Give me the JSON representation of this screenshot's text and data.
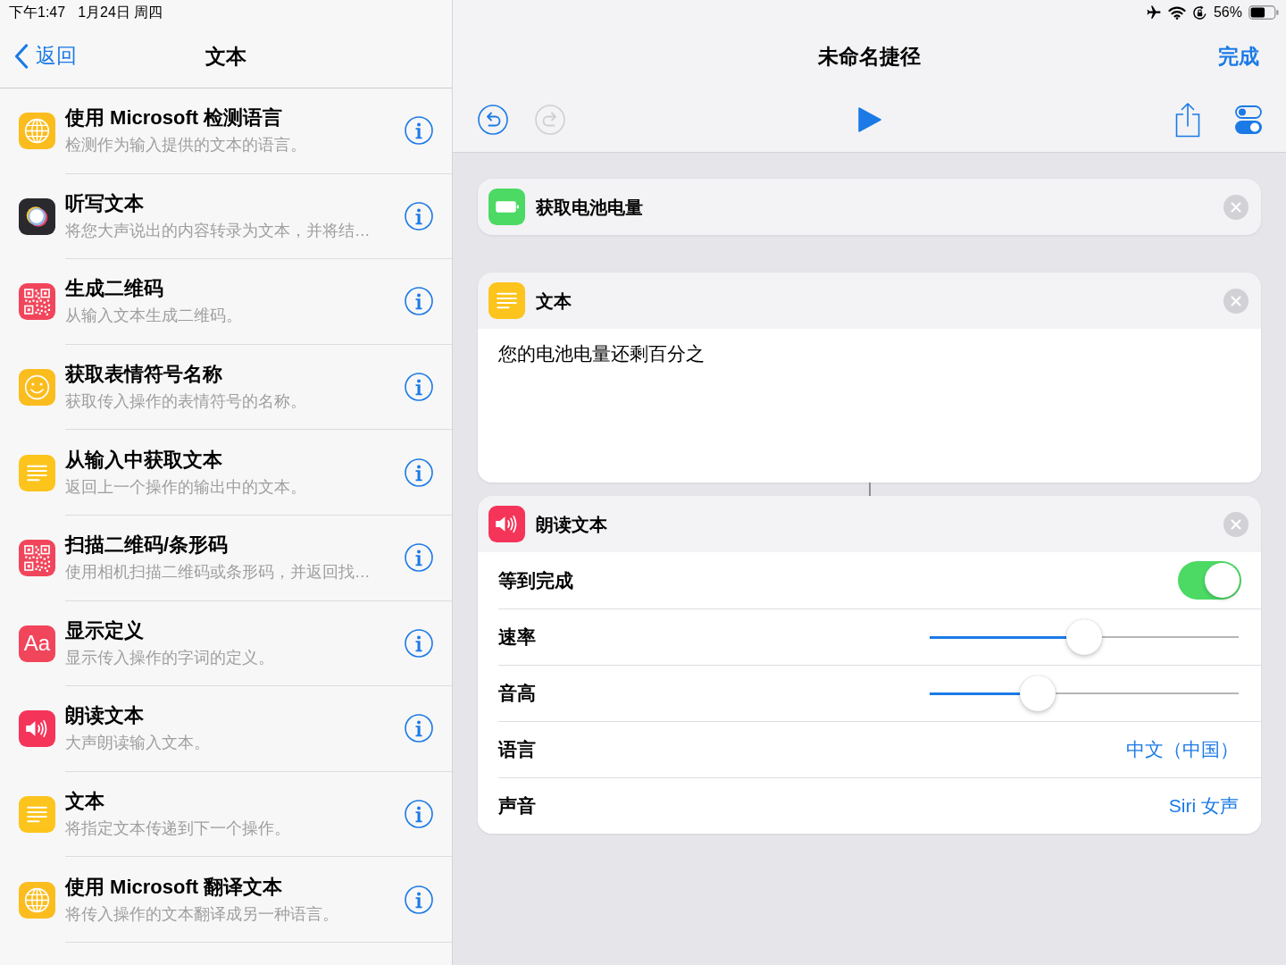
{
  "status_bar": {
    "time": "下午1:47",
    "date": "1月24日 周四",
    "battery": "56%"
  },
  "sidebar": {
    "back": "返回",
    "title": "文本",
    "items": [
      {
        "kind": "globe",
        "title": "使用 Microsoft 检测语言",
        "description": "检测作为输入提供的文本的语言。"
      },
      {
        "kind": "dictation",
        "title": "听写文本",
        "description": "将您大声说出的内容转录为文本，并将结…"
      },
      {
        "kind": "qr",
        "title": "生成二维码",
        "description": "从输入文本生成二维码。"
      },
      {
        "kind": "emoji",
        "title": "获取表情符号名称",
        "description": "获取传入操作的表情符号的名称。"
      },
      {
        "kind": "text",
        "title": "从输入中获取文本",
        "description": "返回上一个操作的输出中的文本。"
      },
      {
        "kind": "qr",
        "title": "扫描二维码/条形码",
        "description": "使用相机扫描二维码或条形码，并返回找…"
      },
      {
        "kind": "dictionary",
        "icon_text": "Aa",
        "title": "显示定义",
        "description": "显示传入操作的字词的定义。"
      },
      {
        "kind": "speaker",
        "title": "朗读文本",
        "description": "大声朗读输入文本。"
      },
      {
        "kind": "text",
        "title": "文本",
        "description": "将指定文本传递到下一个操作。"
      },
      {
        "kind": "globe",
        "title": "使用 Microsoft 翻译文本",
        "description": "将传入操作的文本翻译成另一种语言。"
      }
    ]
  },
  "editor": {
    "title": "未命名捷径",
    "done": "完成",
    "toolbar": {
      "undo": {
        "disabled": false
      },
      "redo": {
        "disabled": true
      }
    },
    "actions": [
      {
        "kind": "battery",
        "title": "获取电池电量",
        "linked": false
      },
      {
        "kind": "text",
        "title": "文本",
        "linked": false,
        "text": "您的电池电量还剩百分之"
      },
      {
        "kind": "speaker",
        "title": "朗读文本",
        "linked": true,
        "parameters": [
          {
            "kind": "toggle",
            "label": "等到完成",
            "on": true
          },
          {
            "kind": "slider",
            "label": "速率",
            "level": 0.5
          },
          {
            "kind": "slider",
            "label": "音高",
            "level": 0.35
          },
          {
            "kind": "value",
            "label": "语言",
            "value": "中文（中国）"
          },
          {
            "kind": "value",
            "label": "声音",
            "value": "Siri 女声"
          }
        ]
      }
    ]
  }
}
